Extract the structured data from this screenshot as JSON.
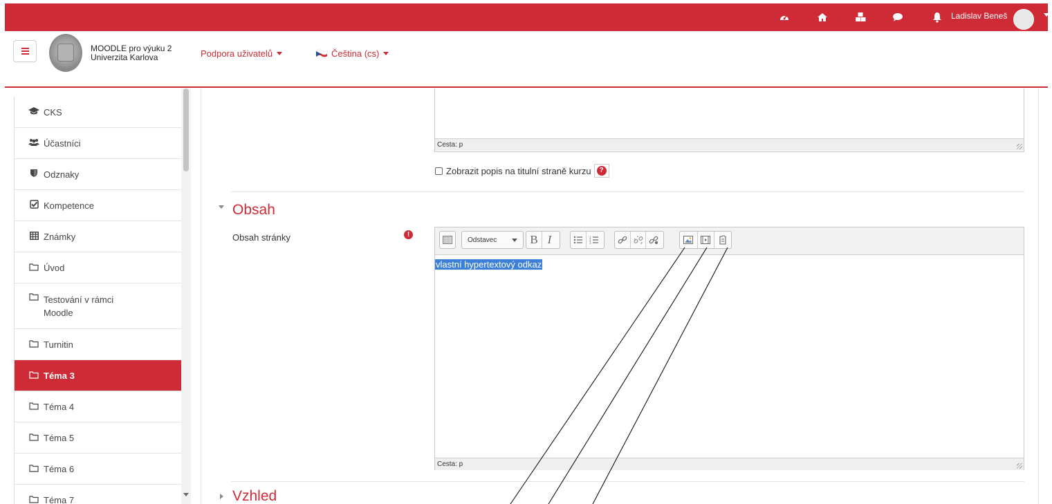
{
  "topbar": {
    "icons": [
      "dashboard-icon",
      "home-icon",
      "cubes-icon",
      "chat-icon",
      "bell-icon"
    ],
    "user_name": "Ladislav Beneš"
  },
  "header": {
    "site_name_line1": "MOODLE pro výuku 2",
    "site_name_line2": "Univerzita Karlova",
    "support_link": "Podpora uživatelů",
    "language": "Čeština (cs)"
  },
  "sidebar": {
    "items": [
      {
        "label": "CKS",
        "icon": "graduation-cap-icon"
      },
      {
        "label": "Účastníci",
        "icon": "users-icon"
      },
      {
        "label": "Odznaky",
        "icon": "shield-icon"
      },
      {
        "label": "Kompetence",
        "icon": "check-square-icon"
      },
      {
        "label": "Známky",
        "icon": "table-icon"
      },
      {
        "label": "Úvod",
        "icon": "folder-icon"
      },
      {
        "label": "Testování v rámci",
        "label2": "Moodle",
        "icon": "folder-icon"
      },
      {
        "label": "Turnitin",
        "icon": "folder-icon"
      },
      {
        "label": "Téma 3",
        "icon": "folder-icon",
        "active": true
      },
      {
        "label": "Téma 4",
        "icon": "folder-icon"
      },
      {
        "label": "Téma 5",
        "icon": "folder-icon"
      },
      {
        "label": "Téma 6",
        "icon": "folder-icon"
      },
      {
        "label": "Téma 7",
        "icon": "folder-icon"
      }
    ]
  },
  "main": {
    "top_editor_path": "Cesta: p",
    "show_description_label": "Zobrazit popis na titulní straně kurzu",
    "section_obsah": "Obsah",
    "content_label": "Obsah stránky",
    "toolbar": {
      "paragraph_select": "Odstavec",
      "bold": "B",
      "italic": "I"
    },
    "editor_text": "vlastní hypertextový odkaz",
    "editor_path": "Cesta: p",
    "section_vzhled": "Vzhled"
  },
  "colors": {
    "brand_red": "#cf2b36",
    "selection_blue": "#3c7fd8"
  }
}
